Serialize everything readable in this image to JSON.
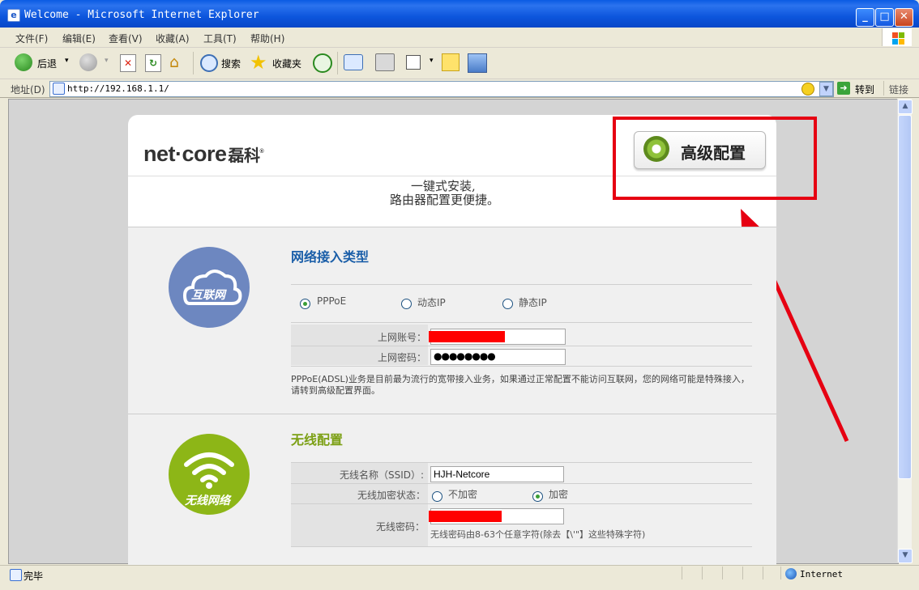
{
  "window": {
    "title": "Welcome - Microsoft Internet Explorer"
  },
  "menu": [
    "文件(F)",
    "编辑(E)",
    "查看(V)",
    "收藏(A)",
    "工具(T)",
    "帮助(H)"
  ],
  "toolbar": {
    "back": "后退",
    "search": "搜索",
    "favorites": "收藏夹"
  },
  "address": {
    "label": "地址(D)",
    "url": "http://192.168.1.1/",
    "go": "转到",
    "links": "链接"
  },
  "page": {
    "logo": "net·core",
    "logo_cn": "磊科",
    "advanced_button": "高级配置",
    "slogan_line1": "一键式安装,",
    "slogan_line2": "路由器配置更便捷。",
    "internet": {
      "icon_label": "互联网",
      "title": "网络接入类型",
      "types": [
        "PPPoE",
        "动态IP",
        "静态IP"
      ],
      "selected_type": "PPPoE",
      "account_label": "上网账号：",
      "password_label": "上网密码：",
      "password_value": "●●●●●●●●",
      "note": "PPPoE(ADSL)业务是目前最为流行的宽带接入业务，如果通过正常配置不能访问互联网，您的网络可能是特殊接入，请转到高级配置界面。"
    },
    "wireless": {
      "icon_label": "无线网络",
      "title": "无线配置",
      "ssid_label": "无线名称（SSID）:",
      "ssid_value": "HJH-Netcore",
      "encrypt_label": "无线加密状态：",
      "encrypt_options": [
        "不加密",
        "加密"
      ],
      "encrypt_selected": "加密",
      "password_label": "无线密码：",
      "password_hint": "无线密码由8-63个任意字符(除去【\\'\"】这些特殊字符)"
    }
  },
  "status": {
    "text": "完毕",
    "zone": "Internet"
  },
  "colors": {
    "highlight": "#e60012",
    "brand_blue": "#1a5ea8",
    "brand_green": "#7ca015"
  }
}
